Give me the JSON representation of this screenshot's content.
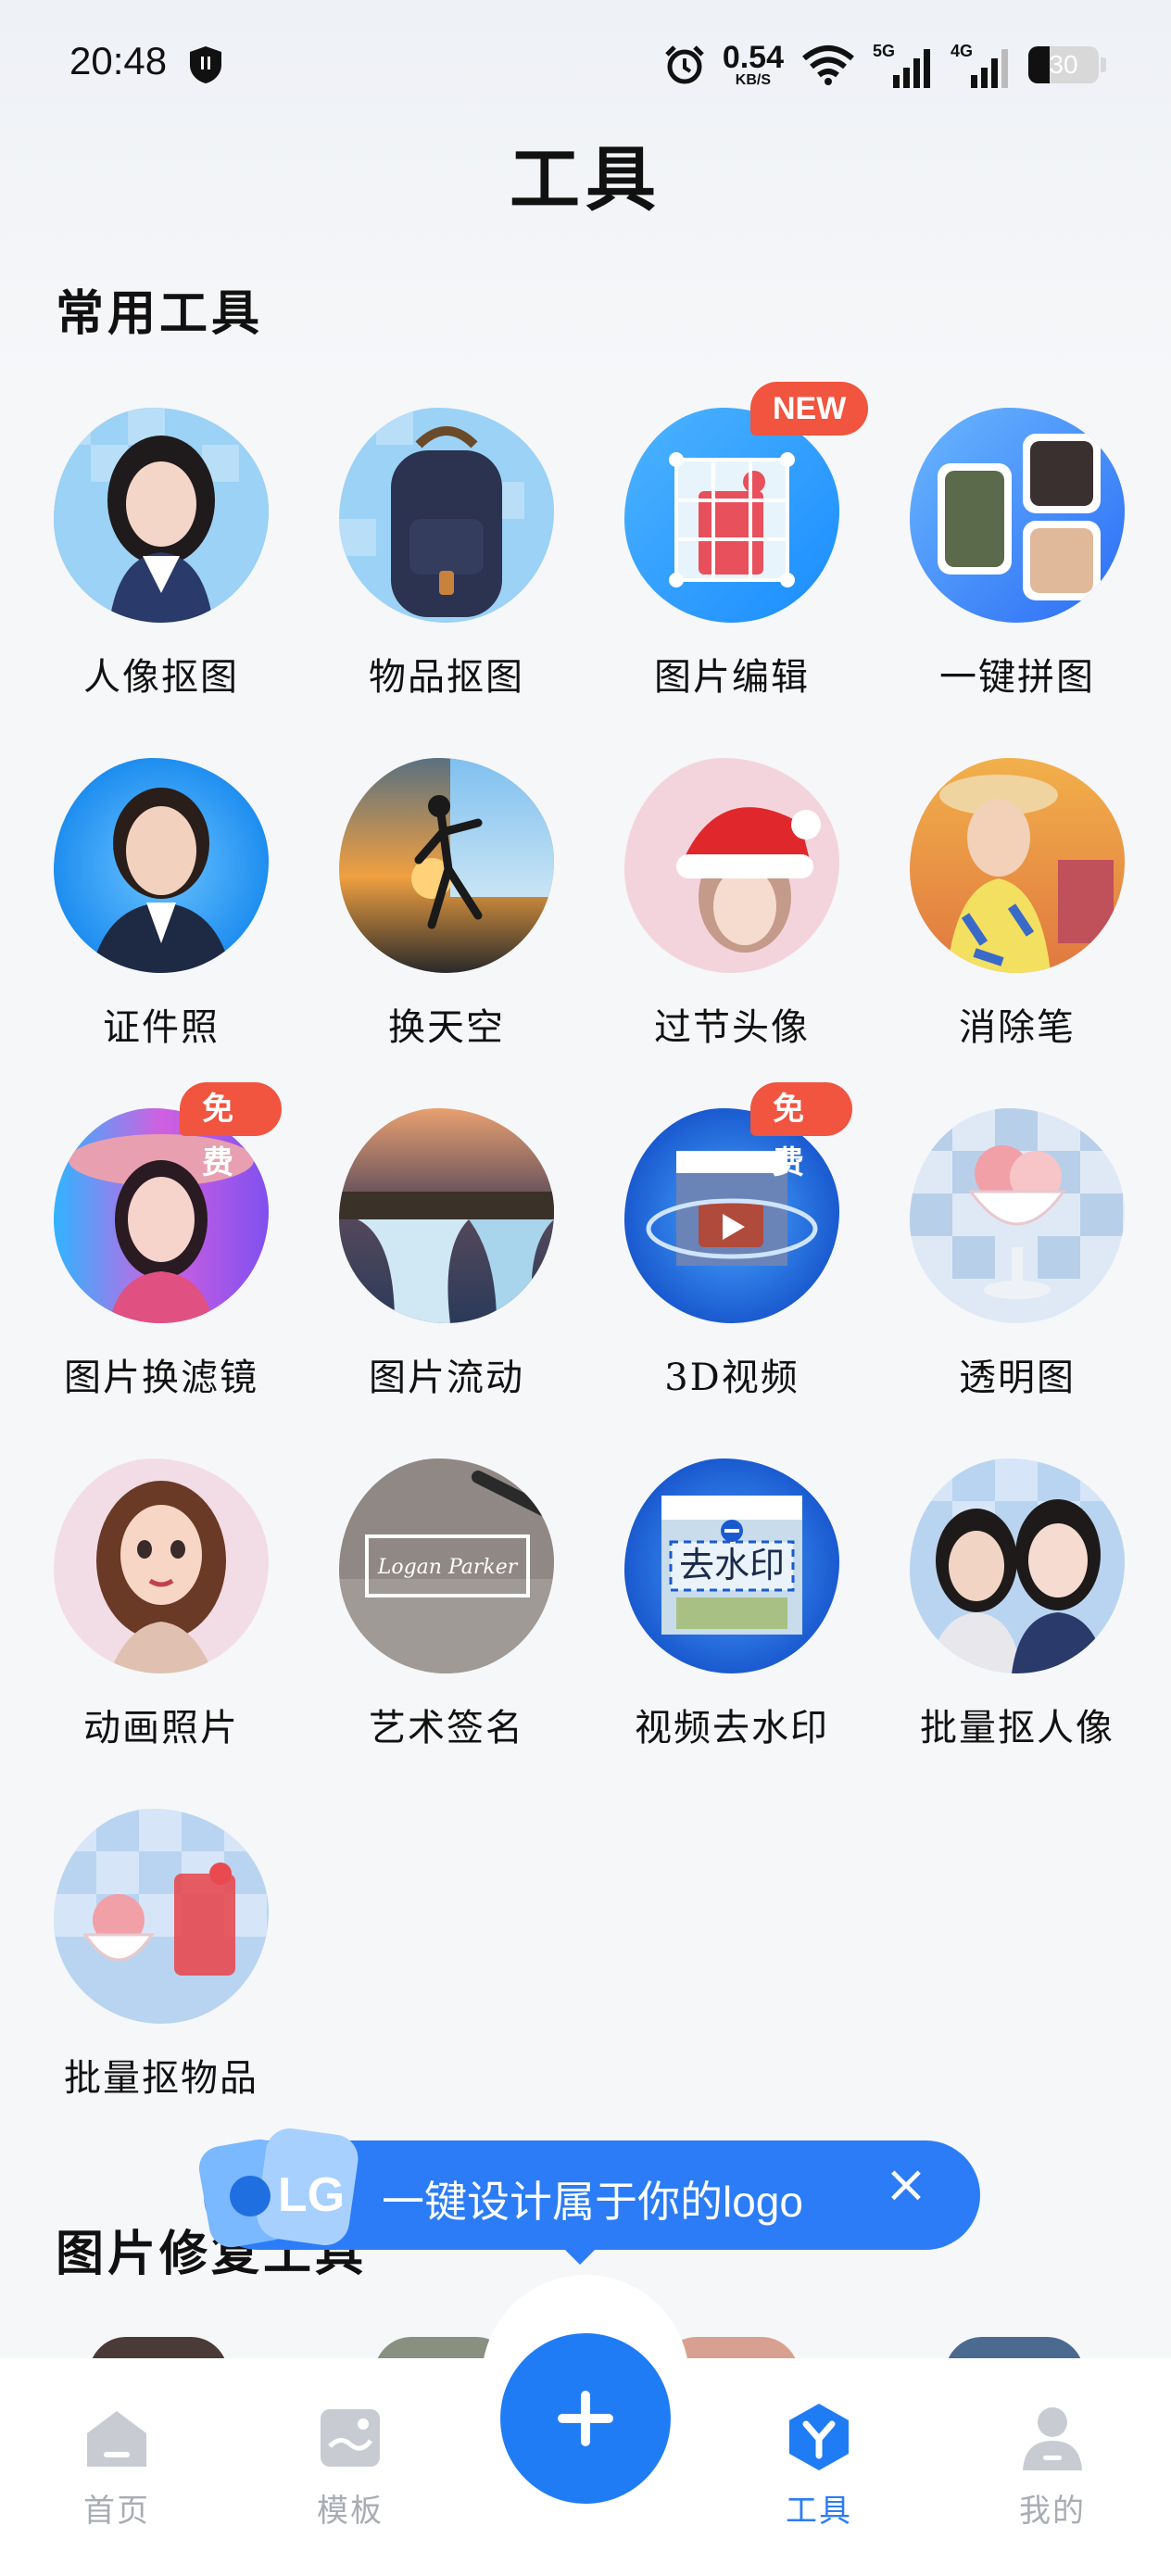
{
  "status_bar": {
    "time": "20:48",
    "speed_value": "0.54",
    "speed_unit": "KB/S",
    "net_5g": "5G",
    "net_4g": "4G",
    "battery": "30"
  },
  "page_title": "工具",
  "sections": {
    "common_tools": "常用工具",
    "photo_repair": "图片修复工具"
  },
  "tools": [
    {
      "label": "人像抠图",
      "badge": "",
      "icon": "portrait-cutout-icon"
    },
    {
      "label": "物品抠图",
      "badge": "",
      "icon": "object-cutout-icon"
    },
    {
      "label": "图片编辑",
      "badge": "NEW",
      "icon": "image-edit-icon"
    },
    {
      "label": "一键拼图",
      "badge": "",
      "icon": "collage-icon"
    },
    {
      "label": "证件照",
      "badge": "",
      "icon": "id-photo-icon"
    },
    {
      "label": "换天空",
      "badge": "",
      "icon": "sky-replace-icon"
    },
    {
      "label": "过节头像",
      "badge": "",
      "icon": "holiday-avatar-icon"
    },
    {
      "label": "消除笔",
      "badge": "",
      "icon": "eraser-pen-icon"
    },
    {
      "label": "图片换滤镜",
      "badge": "免费",
      "icon": "filter-icon"
    },
    {
      "label": "图片流动",
      "badge": "",
      "icon": "image-flow-icon"
    },
    {
      "label": "3D视频",
      "badge": "免费",
      "icon": "3d-video-icon"
    },
    {
      "label": "透明图",
      "badge": "",
      "icon": "transparent-image-icon"
    },
    {
      "label": "动画照片",
      "badge": "",
      "icon": "animated-photo-icon"
    },
    {
      "label": "艺术签名",
      "badge": "",
      "icon": "art-signature-icon"
    },
    {
      "label": "视频去水印",
      "badge": "",
      "icon": "video-watermark-remove-icon"
    },
    {
      "label": "批量抠人像",
      "badge": "",
      "icon": "batch-portrait-cutout-icon"
    },
    {
      "label": "批量抠物品",
      "badge": "",
      "icon": "batch-object-cutout-icon"
    }
  ],
  "watermark_text": "去水印",
  "signature_text": "Logan Parker",
  "banner": {
    "text": "一键设计属于你的logo",
    "close": "×",
    "logo_letters": "LG"
  },
  "bottom_nav": [
    {
      "label": "首页",
      "active": false
    },
    {
      "label": "模板",
      "active": false
    },
    {
      "label": "工具",
      "active": true
    },
    {
      "label": "我的",
      "active": false
    }
  ],
  "colors": {
    "accent": "#1f7cf5",
    "badge": "#f1543f",
    "inactive": "#a8acb4"
  }
}
